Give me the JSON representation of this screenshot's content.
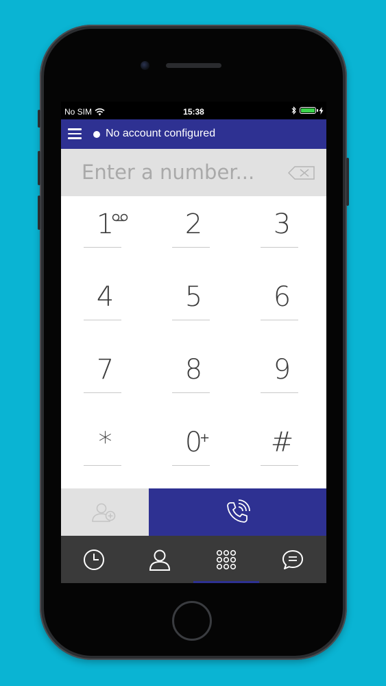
{
  "status": {
    "carrier": "No SIM",
    "time": "15:38"
  },
  "header": {
    "account_status": "No account configured"
  },
  "dialer": {
    "placeholder": "Enter a number...",
    "value": ""
  },
  "keypad": {
    "keys": [
      {
        "digit": "1",
        "sup": ""
      },
      {
        "digit": "2",
        "sup": ""
      },
      {
        "digit": "3",
        "sup": ""
      },
      {
        "digit": "4",
        "sup": ""
      },
      {
        "digit": "5",
        "sup": ""
      },
      {
        "digit": "6",
        "sup": ""
      },
      {
        "digit": "7",
        "sup": ""
      },
      {
        "digit": "8",
        "sup": ""
      },
      {
        "digit": "9",
        "sup": ""
      },
      {
        "digit": "*",
        "sup": ""
      },
      {
        "digit": "0",
        "sup": "+"
      },
      {
        "digit": "#",
        "sup": ""
      }
    ]
  },
  "tabs": [
    {
      "icon": "clock-icon"
    },
    {
      "icon": "contact-icon"
    },
    {
      "icon": "keypad-grid-icon",
      "active": true
    },
    {
      "icon": "chat-icon"
    }
  ],
  "colors": {
    "background": "#0ab4d3",
    "brand": "#2e3192",
    "input_bar": "#e1e1e1",
    "tab_bar": "#3a3a3a"
  }
}
